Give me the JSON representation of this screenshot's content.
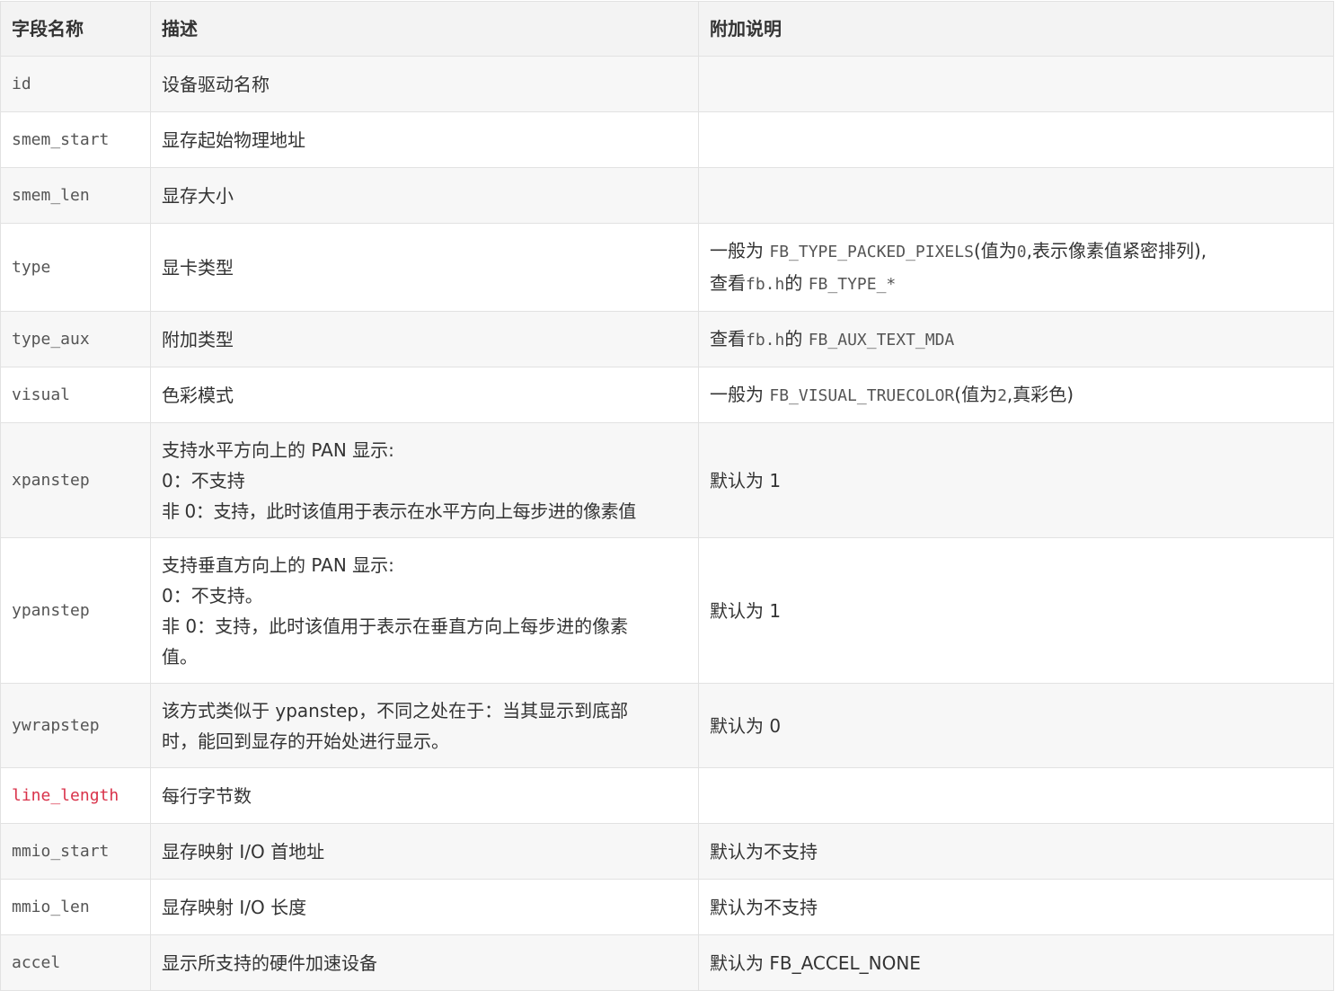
{
  "headers": {
    "field": "字段名称",
    "desc": "描述",
    "note": "附加说明"
  },
  "rows": [
    {
      "field": "id",
      "desc": [
        "设备驱动名称"
      ]
    },
    {
      "field": "smem_start",
      "desc": [
        "显存起始物理地址"
      ]
    },
    {
      "field": "smem_len",
      "desc": [
        "显存大小"
      ]
    },
    {
      "field": "type",
      "desc": [
        "显卡类型"
      ]
    },
    {
      "field": "type_aux",
      "desc": [
        "附加类型"
      ]
    },
    {
      "field": "visual",
      "desc": [
        "色彩模式"
      ]
    },
    {
      "field": "xpanstep",
      "desc": [
        "支持水平方向上的 PAN 显示:",
        "0：不支持",
        "非 0：支持，此时该值用于表示在水平方向上每步进的像素值"
      ],
      "note": "默认为 1"
    },
    {
      "field": "ypanstep",
      "desc": [
        "支持垂直方向上的 PAN 显示:",
        "0：不支持。",
        "非 0：支持，此时该值用于表示在垂直方向上每步进的像素",
        "值。"
      ],
      "note": "默认为 1"
    },
    {
      "field": "ywrapstep",
      "desc": [
        "该方式类似于 ypanstep，不同之处在于：当其显示到底部",
        "时，能回到显存的开始处进行显示。"
      ],
      "note": "默认为 0"
    },
    {
      "field": "line_length",
      "desc": [
        "每行字节数"
      ]
    },
    {
      "field": "mmio_start",
      "desc": [
        "显存映射 I/O 首地址"
      ],
      "note": "默认为不支持"
    },
    {
      "field": "mmio_len",
      "desc": [
        "显存映射 I/O 长度"
      ],
      "note": "默认为不支持"
    },
    {
      "field": "accel",
      "desc": [
        "显示所支持的硬件加速设备"
      ],
      "note": "默认为 FB_ACCEL_NONE"
    }
  ],
  "notes_rich": {
    "type_a": "一般为 ",
    "type_b": "FB_TYPE_PACKED_PIXELS",
    "type_c": "(值为",
    "type_d": "0",
    "type_e": ",表示像素值紧密排列),",
    "type_f": "查看",
    "type_g": "fb.h",
    "type_h": "的 ",
    "type_i": "FB_TYPE_*",
    "aux_a": "查看",
    "aux_b": "fb.h",
    "aux_c": "的 ",
    "aux_d": "FB_AUX_TEXT_MDA",
    "visual_a": "一般为 ",
    "visual_b": "FB_VISUAL_TRUECOLOR",
    "visual_c": "(值为",
    "visual_d": "2",
    "visual_e": ",真彩色)"
  },
  "colors": {
    "highlight_field": "#d9324a",
    "border": "#e2e2e2",
    "header_bg": "#f3f3f3",
    "stripe_bg": "#f7f7f7"
  }
}
